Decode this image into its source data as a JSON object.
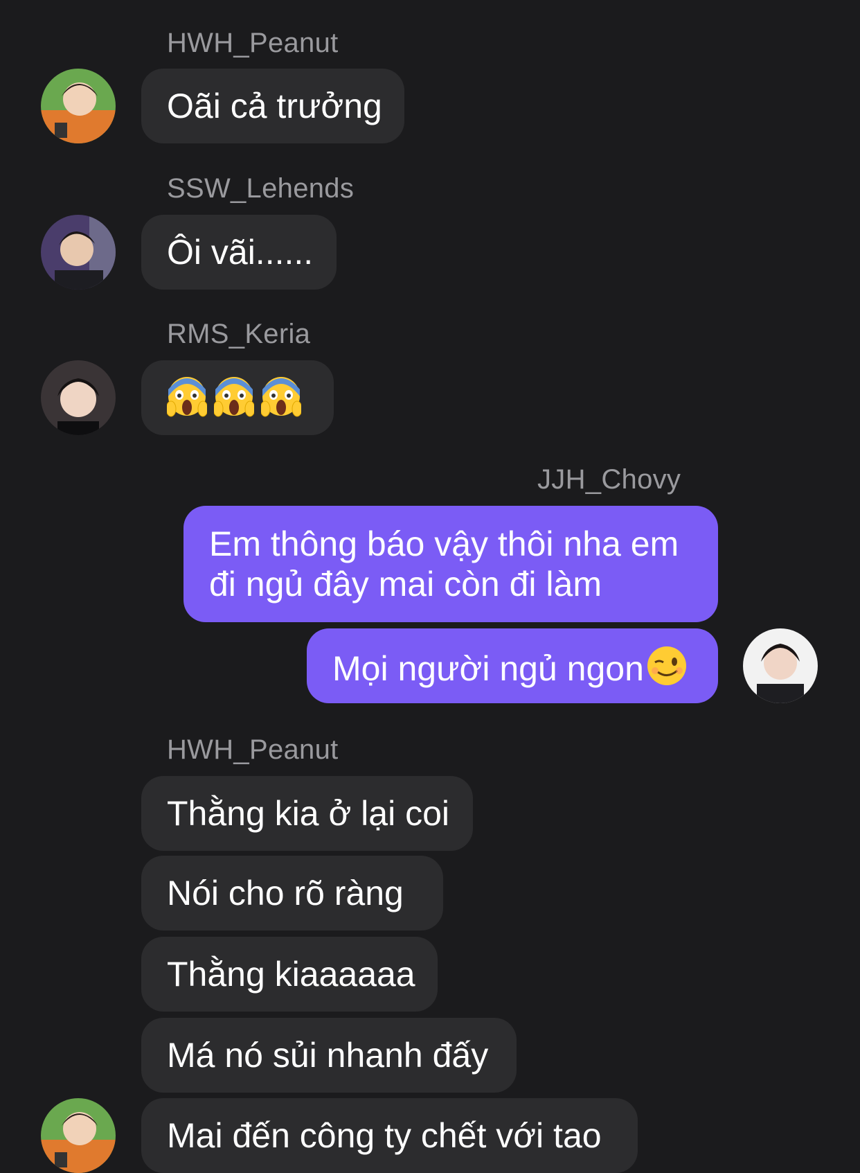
{
  "messages": [
    {
      "sender": "HWH_Peanut",
      "text": "Oãi cả trưởng"
    },
    {
      "sender": "SSW_Lehends",
      "text": "Ôi vãi......"
    },
    {
      "sender": "RMS_Keria",
      "text": "",
      "emojis": [
        "scream-emoji",
        "scream-emoji",
        "scream-emoji"
      ]
    },
    {
      "sender": "JJH_Chovy",
      "text": "Em thông báo vậy thôi nha em đi ngủ đây mai còn đi làm"
    },
    {
      "sender": "JJH_Chovy",
      "text": "Mọi người ngủ ngon",
      "emoji": "wink-emoji"
    },
    {
      "sender": "HWH_Peanut",
      "text": "Thằng kia ở lại coi"
    },
    {
      "sender": "HWH_Peanut",
      "text": "Nói cho rõ ràng"
    },
    {
      "sender": "HWH_Peanut",
      "text": "Thằng kiaaaaaa"
    },
    {
      "sender": "HWH_Peanut",
      "text": "Má nó sủi nhanh đấy"
    },
    {
      "sender": "HWH_Peanut",
      "text": "Mai đến công ty chết với tao"
    }
  ],
  "colors": {
    "background": "#1b1b1d",
    "incoming_bubble": "#2c2c2e",
    "outgoing_bubble": "#7b5cf5",
    "sender_name": "#9a9a9e"
  }
}
